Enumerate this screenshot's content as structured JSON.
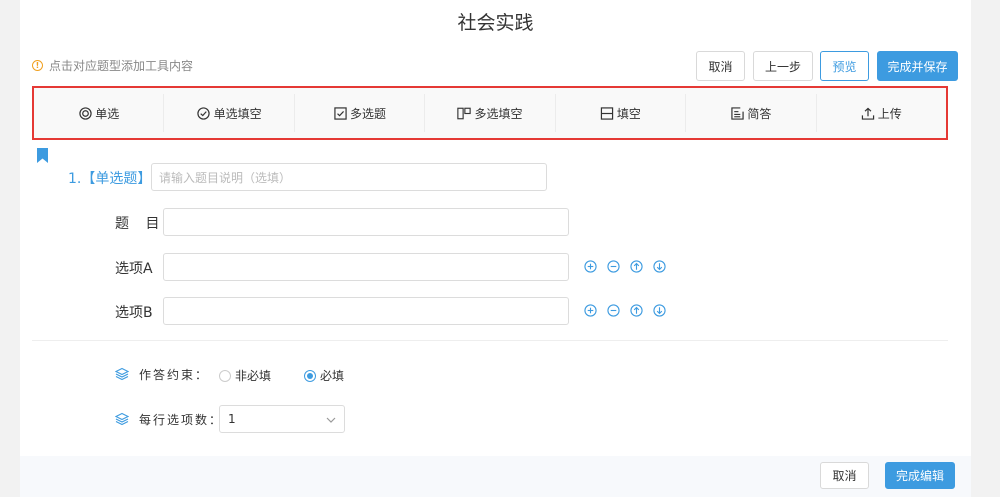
{
  "header": {
    "title": "社会实践",
    "hint": "点击对应题型添加工具内容",
    "hint_icon": "info-icon",
    "buttons": {
      "cancel": "取消",
      "prev": "上一步",
      "preview": "预览",
      "finish_save": "完成并保存"
    }
  },
  "toolbar": {
    "items": [
      {
        "label": "单选",
        "icon": "radio-icon"
      },
      {
        "label": "单选填空",
        "icon": "check-circle-icon"
      },
      {
        "label": "多选题",
        "icon": "checkbox-icon"
      },
      {
        "label": "多选填空",
        "icon": "multi-fill-icon"
      },
      {
        "label": "填空",
        "icon": "fill-blank-icon"
      },
      {
        "label": "简答",
        "icon": "edit-note-icon"
      },
      {
        "label": "上传",
        "icon": "upload-icon"
      }
    ]
  },
  "question": {
    "heading": "1.【单选题】",
    "desc_placeholder": "请输入题目说明（选填）",
    "title_label": "题  目",
    "title_value": "",
    "option_a_label": "选项A",
    "option_a_value": "",
    "option_b_label": "选项B",
    "option_b_value": ""
  },
  "settings": {
    "constraint_label": "作答约束：",
    "constraint_options": [
      "非必填",
      "必填"
    ],
    "constraint_selected": "必填",
    "per_row_label": "每行选项数：",
    "per_row_value": "1"
  },
  "footer": {
    "cancel": "取消",
    "finish_edit": "完成编辑"
  },
  "colors": {
    "accent": "#3d9be0",
    "highlight_border": "#e53935",
    "hint_icon": "#f0a020"
  }
}
